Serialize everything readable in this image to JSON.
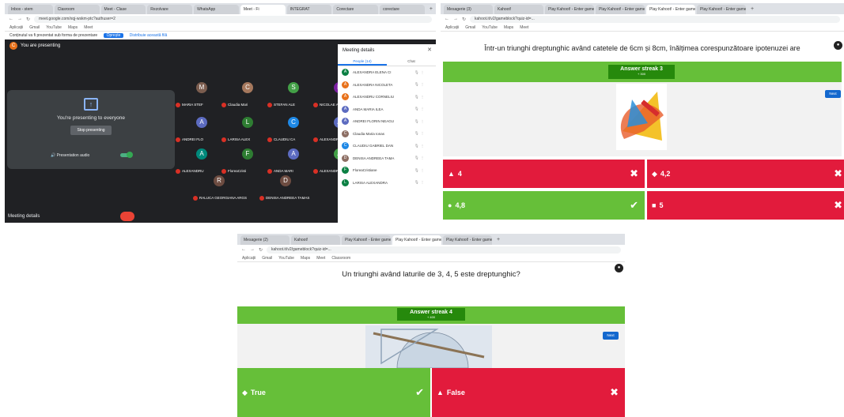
{
  "meet": {
    "tabs": [
      "Inbox - stem",
      "Clasroom",
      "Meet - Clase",
      "Rezolvare",
      "WhatsApp",
      "Meet - Fi",
      "INTEGRAT",
      "Corectare",
      "corectare"
    ],
    "url": "meet.google.com/xqj-wskm-ptc?authuser=2",
    "bookmarks": [
      "Aplicații",
      "Gmail",
      "YouTube",
      "Maps",
      "Meet"
    ],
    "share_text": "Conținutul va fi prezentat sub forma de prezentare",
    "share_btn": "Oprește",
    "share_link": "Distribuie această filă",
    "presenting": "You are presenting",
    "presenter_initial": "C",
    "card_title": "You're presenting to everyone",
    "stop_btn": "Stop presenting",
    "audio_label": "Presentation audio",
    "bottom_label": "Meeting details",
    "tiles": [
      {
        "i": "M",
        "name": "MARIA STEF",
        "c": "#7b5d4f"
      },
      {
        "i": "C",
        "name": "Claudia Mari",
        "c": "#a5785d"
      },
      {
        "i": "S",
        "name": "STEFAN ALE",
        "c": "#43a047"
      },
      {
        "i": "N",
        "name": "NICOLAE AL",
        "c": "#7b1fa2"
      },
      {
        "i": "A",
        "name": "ANDREI FLO",
        "c": "#5c6bc0"
      },
      {
        "i": "L",
        "name": "LARISA ALEX",
        "c": "#2e7d32"
      },
      {
        "i": "C",
        "name": "CLAUDIU CA",
        "c": "#1e88e5"
      },
      {
        "i": "A",
        "name": "ALEXANDRA",
        "c": "#5c6bc0"
      },
      {
        "i": "A",
        "name": "ALEXANDRU",
        "c": "#00897b"
      },
      {
        "i": "F",
        "name": "FloreaCristi",
        "c": "#2e7d32"
      },
      {
        "i": "A",
        "name": "ANDA MARI",
        "c": "#5c6bc0"
      },
      {
        "i": "A",
        "name": "ALEXANDRA",
        "c": "#43a047"
      },
      {
        "i": "R",
        "name": "RALUCA GEORGIANA ARGS",
        "c": "#6d4c41"
      },
      {
        "i": "D",
        "name": "DENISA ANDREEA TAMAS",
        "c": "#6d4c41"
      }
    ],
    "panel_title": "Meeting details",
    "panel_tab_people": "People (14)",
    "panel_tab_chat": "Chat",
    "people": [
      {
        "i": "A",
        "name": "ALEXANDRA ELENA CI",
        "c": "#0b8043"
      },
      {
        "i": "A",
        "name": "ALEXANDRA NICOLETA",
        "c": "#e8711a"
      },
      {
        "i": "A",
        "name": "ALEXANDRU CORNELIU",
        "c": "#e8711a"
      },
      {
        "i": "A",
        "name": "ANDA MARIA ILEA",
        "c": "#5c6bc0"
      },
      {
        "i": "A",
        "name": "ANDREI FLORIN NEAGU",
        "c": "#5c6bc0"
      },
      {
        "i": "C",
        "name": "Claudia Maria Ionas",
        "c": "#8d6e63"
      },
      {
        "i": "C",
        "name": "CLAUDIU GABRIEL DAN",
        "c": "#1e88e5"
      },
      {
        "i": "D",
        "name": "DENISA ANDREEA TAMA",
        "c": "#8d6e63"
      },
      {
        "i": "F",
        "name": "FloreaCristiane",
        "c": "#0b8043"
      },
      {
        "i": "L",
        "name": "LARISA ALEXANDRA",
        "c": "#0b8043"
      }
    ]
  },
  "quiz1": {
    "tabs": [
      "Mesagerie (3)",
      "Kahoot!",
      "Play Kahoot! - Enter game",
      "Play Kahoot! - Enter game",
      "Play Kahoot! - Enter game",
      "Play Kahoot! - Enter game"
    ],
    "url": "kahoot.it/v2/gameblock?quiz-id=...",
    "question": "Într-un triunghi dreptunghic având catetele de 6cm și 8cm, înălțimea corespunzătoare ipotenuzei are",
    "streak": "Answer streak 3",
    "streak_sub": "+ 300",
    "next": "Next",
    "answers": [
      {
        "label": "4",
        "sym": "▲",
        "color": "#e21b3c",
        "mark": "✖"
      },
      {
        "label": "4,2",
        "sym": "◆",
        "color": "#e21b3c",
        "mark": "✖"
      },
      {
        "label": "4,8",
        "sym": "●",
        "color": "#66bf39",
        "mark": "✔"
      },
      {
        "label": "5",
        "sym": "■",
        "color": "#e21b3c",
        "mark": "✖"
      }
    ]
  },
  "quiz2": {
    "tabs": [
      "Mesagerie (2)",
      "Kahoot!",
      "Play Kahoot! - Enter game",
      "Play Kahoot! - Enter game",
      "Play Kahoot! - Enter game"
    ],
    "url": "kahoot.it/v2/gameblock?quiz-id=...",
    "bookmarks": [
      "Aplicații",
      "Gmail",
      "YouTube",
      "Maps",
      "Meet",
      "Classroom"
    ],
    "question": "Un triunghi având laturile de 3, 4, 5 este dreptunghic?",
    "streak": "Answer streak 4",
    "streak_sub": "+ 400",
    "next": "Next",
    "answers": [
      {
        "label": "True",
        "sym": "◆",
        "color": "#66bf39",
        "mark": "✔"
      },
      {
        "label": "False",
        "sym": "▲",
        "color": "#e21b3c",
        "mark": "✖"
      }
    ]
  }
}
